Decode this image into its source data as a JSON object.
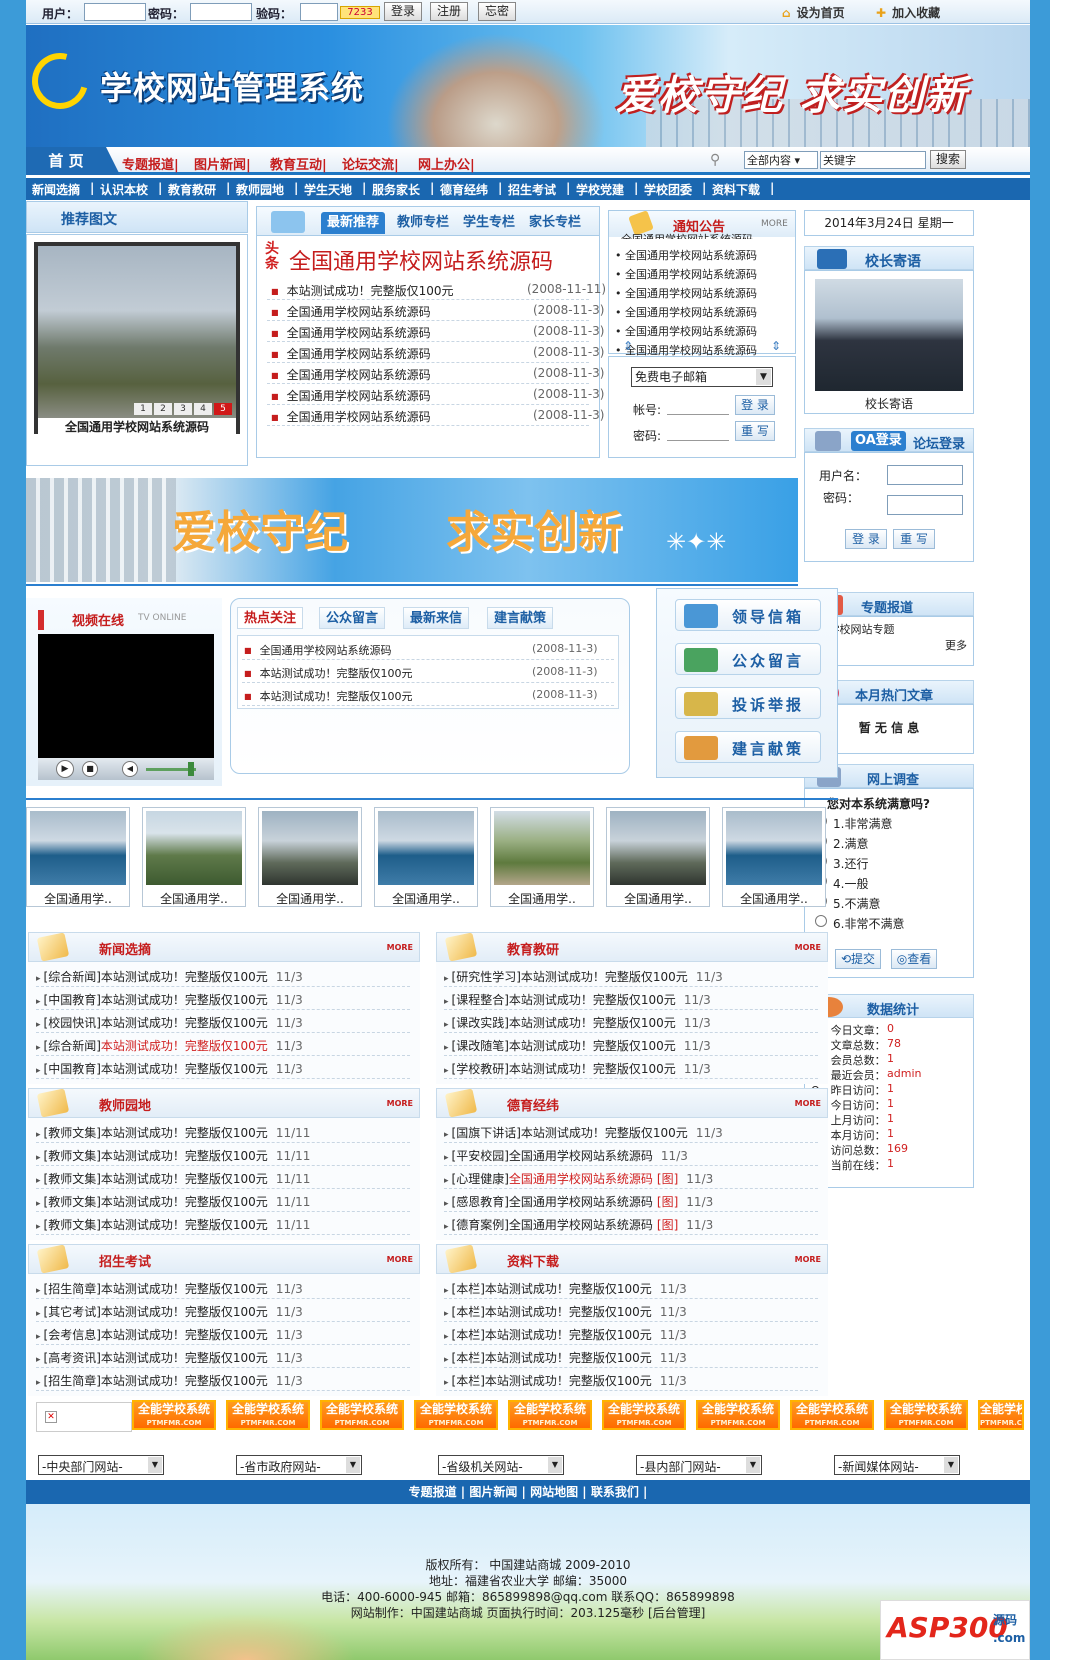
{
  "topbar": {
    "user_label": "用户：",
    "pass_label": "密码：",
    "code_label": "验码：",
    "code_image": "7233",
    "login_btn": "登录",
    "register_btn": "注册",
    "forgot_btn": "忘密",
    "set_home": "设为首页",
    "add_fav": "加入收藏"
  },
  "banner": {
    "site_title": "学校网站管理系统",
    "slogan": "爱校守纪 求实创新"
  },
  "mainnav": {
    "home": "首 页",
    "items": [
      "专题报道|",
      "图片新闻|",
      "教育互动|",
      "论坛交流|",
      "网上办公|"
    ],
    "scope": "全部内容",
    "keyword": "关键字",
    "search_btn": "搜索"
  },
  "subnav": [
    "新闻选摘",
    "|",
    "认识本校",
    "|",
    "教育教研",
    "|",
    "教师园地",
    "|",
    "学生天地",
    "|",
    "服务家长",
    "|",
    "德育经纬",
    "|",
    "招生考试",
    "|",
    "学校党建",
    "|",
    "学校团委",
    "|",
    "资料下载",
    "|"
  ],
  "recommend": {
    "title": "推荐图文",
    "caption": "全国通用学校网站系统源码",
    "pages": [
      "1",
      "2",
      "3",
      "4",
      "5"
    ]
  },
  "center_tabs": [
    "最新推荐",
    "教师专栏",
    "学生专栏",
    "家长专栏"
  ],
  "headline": {
    "tag": "头条",
    "title": "全国通用学校网站系统源码"
  },
  "latest": [
    {
      "text": "本站测试成功！完整版仅100元",
      "date": "(2008-11-11)"
    },
    {
      "text": "全国通用学校网站系统源码",
      "date": "(2008-11-3)"
    },
    {
      "text": "全国通用学校网站系统源码",
      "date": "(2008-11-3)"
    },
    {
      "text": "全国通用学校网站系统源码",
      "date": "(2008-11-3)"
    },
    {
      "text": "全国通用学校网站系统源码",
      "date": "(2008-11-3)"
    },
    {
      "text": "全国通用学校网站系统源码",
      "date": "(2008-11-3)"
    },
    {
      "text": "全国通用学校网站系统源码",
      "date": "(2008-11-3)"
    }
  ],
  "notice": {
    "title": "通知公告",
    "more": "MORE",
    "items": [
      "全国通用学校网站系统源码",
      "全国通用学校网站系统源码",
      "全国通用学校网站系统源码",
      "全国通用学校网站系统源码",
      "全国通用学校网站系统源码",
      "全国通用学校网站系统源码"
    ],
    "top_partial": "全国通用学校网站系统源码"
  },
  "mail": {
    "select": "免费电子邮箱",
    "account_label": "帐号:",
    "pass_label": "密码:",
    "login_btn": "登 录",
    "reset_btn": "重 写"
  },
  "date_line": "2014年3月24日 星期一",
  "principal": {
    "title": "校长寄语",
    "caption": "校长寄语"
  },
  "oa_login": {
    "tab1": "OA登录",
    "tab2": "论坛登录",
    "user_label": "用户名：",
    "pass_label": "密码：",
    "login_btn": "登 录",
    "reset_btn": "重 写"
  },
  "mid_banner": {
    "left": "爱校守纪",
    "right": "求实创新"
  },
  "video": {
    "title": "视频在线",
    "sub": "TV ONLINE"
  },
  "hot_tabs": [
    "热点关注",
    "公众留言",
    "最新来信",
    "建言献策"
  ],
  "hot_items": [
    {
      "text": "全国通用学校网站系统源码",
      "date": "(2008-11-3)"
    },
    {
      "text": "本站测试成功！完整版仅100元",
      "date": "(2008-11-3)"
    },
    {
      "text": "本站测试成功！完整版仅100元",
      "date": "(2008-11-3)"
    }
  ],
  "tiles": [
    "领导信箱",
    "公众留言",
    "投诉举报",
    "建言献策"
  ],
  "topics": {
    "title": "专题报道",
    "item": "学校网站专题",
    "more": "更多"
  },
  "hot_month": {
    "title": "本月热门文章",
    "empty": "暂 无 信 息"
  },
  "survey": {
    "title": "网上调查",
    "question": "您对本系统满意吗?",
    "options": [
      "1.非常满意",
      "2.满意",
      "3.还行",
      "4.一般",
      "5.不满意",
      "6.非常不满意"
    ],
    "submit": "提交",
    "view": "查看"
  },
  "stats": {
    "title": "数据统计",
    "rows": [
      {
        "label": "O - 今日文章：",
        "value": "0"
      },
      {
        "label": "O - 文章总数：",
        "value": "78"
      },
      {
        "label": "O - 会员总数：",
        "value": "1"
      },
      {
        "label": "O - 最近会员：",
        "value": "admin"
      },
      {
        "label": "O - 昨日访问：",
        "value": "1"
      },
      {
        "label": "O - 今日访问：",
        "value": "1"
      },
      {
        "label": "O - 上月访问：",
        "value": "1"
      },
      {
        "label": "O - 本月访问：",
        "value": "1"
      },
      {
        "label": "O - 访问总数：",
        "value": "169"
      },
      {
        "label": "O - 当前在线：",
        "value": "1"
      }
    ]
  },
  "thumbs": [
    "全国通用学..",
    "全国通用学..",
    "全国通用学..",
    "全国通用学..",
    "全国通用学..",
    "全国通用学..",
    "全国通用学.."
  ],
  "categories": [
    {
      "title": "新闻选摘",
      "more": "MORE",
      "items": [
        {
          "tag": "[综合新闻]",
          "text": "本站测试成功！完整版仅100元",
          "date": "11/3",
          "hl": false
        },
        {
          "tag": "[中国教育]",
          "text": "本站测试成功！完整版仅100元",
          "date": "11/3",
          "hl": false
        },
        {
          "tag": "[校园快讯]",
          "text": "本站测试成功！完整版仅100元",
          "date": "11/3",
          "hl": false
        },
        {
          "tag": "[综合新闻]",
          "text": "本站测试成功！完整版仅100元",
          "date": "11/3",
          "hl": true
        },
        {
          "tag": "[中国教育]",
          "text": "本站测试成功！完整版仅100元",
          "date": "11/3",
          "hl": false
        }
      ]
    },
    {
      "title": "教育教研",
      "more": "MORE",
      "items": [
        {
          "tag": "[研究性学习]",
          "text": "本站测试成功！完整版仅100元",
          "date": "11/3",
          "hl": false
        },
        {
          "tag": "[课程整合]",
          "text": "本站测试成功！完整版仅100元",
          "date": "11/3",
          "hl": false
        },
        {
          "tag": "[课改实践]",
          "text": "本站测试成功！完整版仅100元",
          "date": "11/3",
          "hl": false
        },
        {
          "tag": "[课改随笔]",
          "text": "本站测试成功！完整版仅100元",
          "date": "11/3",
          "hl": false
        },
        {
          "tag": "[学校教研]",
          "text": "本站测试成功！完整版仅100元",
          "date": "11/3",
          "hl": false
        }
      ]
    },
    {
      "title": "教师园地",
      "more": "MORE",
      "items": [
        {
          "tag": "[教师文集]",
          "text": "本站测试成功！完整版仅100元",
          "date": "11/11",
          "hl": false
        },
        {
          "tag": "[教师文集]",
          "text": "本站测试成功！完整版仅100元",
          "date": "11/11",
          "hl": false
        },
        {
          "tag": "[教师文集]",
          "text": "本站测试成功！完整版仅100元",
          "date": "11/11",
          "hl": false
        },
        {
          "tag": "[教师文集]",
          "text": "本站测试成功！完整版仅100元",
          "date": "11/11",
          "hl": false
        },
        {
          "tag": "[教师文集]",
          "text": "本站测试成功！完整版仅100元",
          "date": "11/11",
          "hl": false
        }
      ]
    },
    {
      "title": "德育经纬",
      "more": "MORE",
      "items": [
        {
          "tag": "[国旗下讲话]",
          "text": "本站测试成功！完整版仅100元",
          "date": "11/3",
          "hl": false,
          "pic": ""
        },
        {
          "tag": "[平安校园]",
          "text": "全国通用学校网站系统源码",
          "date": "11/3",
          "hl": false,
          "pic": ""
        },
        {
          "tag": "[心理健康]",
          "text": "全国通用学校网站系统源码",
          "date": "11/3",
          "hl": true,
          "pic": "[图]"
        },
        {
          "tag": "[感恩教育]",
          "text": "全国通用学校网站系统源码",
          "date": "11/3",
          "hl": false,
          "pic": "[图]"
        },
        {
          "tag": "[德育案例]",
          "text": "全国通用学校网站系统源码",
          "date": "11/3",
          "hl": false,
          "pic": "[图]"
        }
      ]
    },
    {
      "title": "招生考试",
      "more": "MORE",
      "items": [
        {
          "tag": "[招生简章]",
          "text": "本站测试成功！完整版仅100元",
          "date": "11/3",
          "hl": false
        },
        {
          "tag": "[其它考试]",
          "text": "本站测试成功！完整版仅100元",
          "date": "11/3",
          "hl": false
        },
        {
          "tag": "[会考信息]",
          "text": "本站测试成功！完整版仅100元",
          "date": "11/3",
          "hl": false
        },
        {
          "tag": "[高考资讯]",
          "text": "本站测试成功！完整版仅100元",
          "date": "11/3",
          "hl": false
        },
        {
          "tag": "[招生简章]",
          "text": "本站测试成功！完整版仅100元",
          "date": "11/3",
          "hl": false
        }
      ]
    },
    {
      "title": "资料下载",
      "more": "MORE",
      "items": [
        {
          "tag": "[本栏]",
          "text": "本站测试成功！完整版仅100元",
          "date": "11/3",
          "hl": false
        },
        {
          "tag": "[本栏]",
          "text": "本站测试成功！完整版仅100元",
          "date": "11/3",
          "hl": false
        },
        {
          "tag": "[本栏]",
          "text": "本站测试成功！完整版仅100元",
          "date": "11/3",
          "hl": false
        },
        {
          "tag": "[本栏]",
          "text": "本站测试成功！完整版仅100元",
          "date": "11/3",
          "hl": false
        },
        {
          "tag": "[本栏]",
          "text": "本站测试成功！完整版仅100元",
          "date": "11/3",
          "hl": false
        }
      ]
    }
  ],
  "ads": {
    "label": "全能学校系统",
    "sub": "PTMFMR.COM",
    "count": 10
  },
  "link_selects": [
    "-中央部门网站-",
    "-省市政府网站-",
    "-省级机关网站-",
    "-县内部门网站-",
    "-新闻媒体网站-"
  ],
  "footnav": "专题报道 | 图片新闻 | 网站地图 | 联系我们 |",
  "footer": {
    "line1": "版权所有：  中国建站商城  2009-2010",
    "line2": "地址：福建省农业大学  邮编：35000",
    "line3": "电话：400-6000-945 邮箱：865899898@qq.com 联系QQ：865899898",
    "line4": "网站制作：中国建站商城  页面执行时间：203.125毫秒  [后台管理]"
  },
  "watermark": {
    "brand": "ASP300",
    "tag1": "源码",
    "tag2": ".com"
  },
  "colors": {
    "accent": "#1d5fa4",
    "nav": "#1a67b0",
    "red": "#c51d1d",
    "bg": "#3c9bd8"
  }
}
